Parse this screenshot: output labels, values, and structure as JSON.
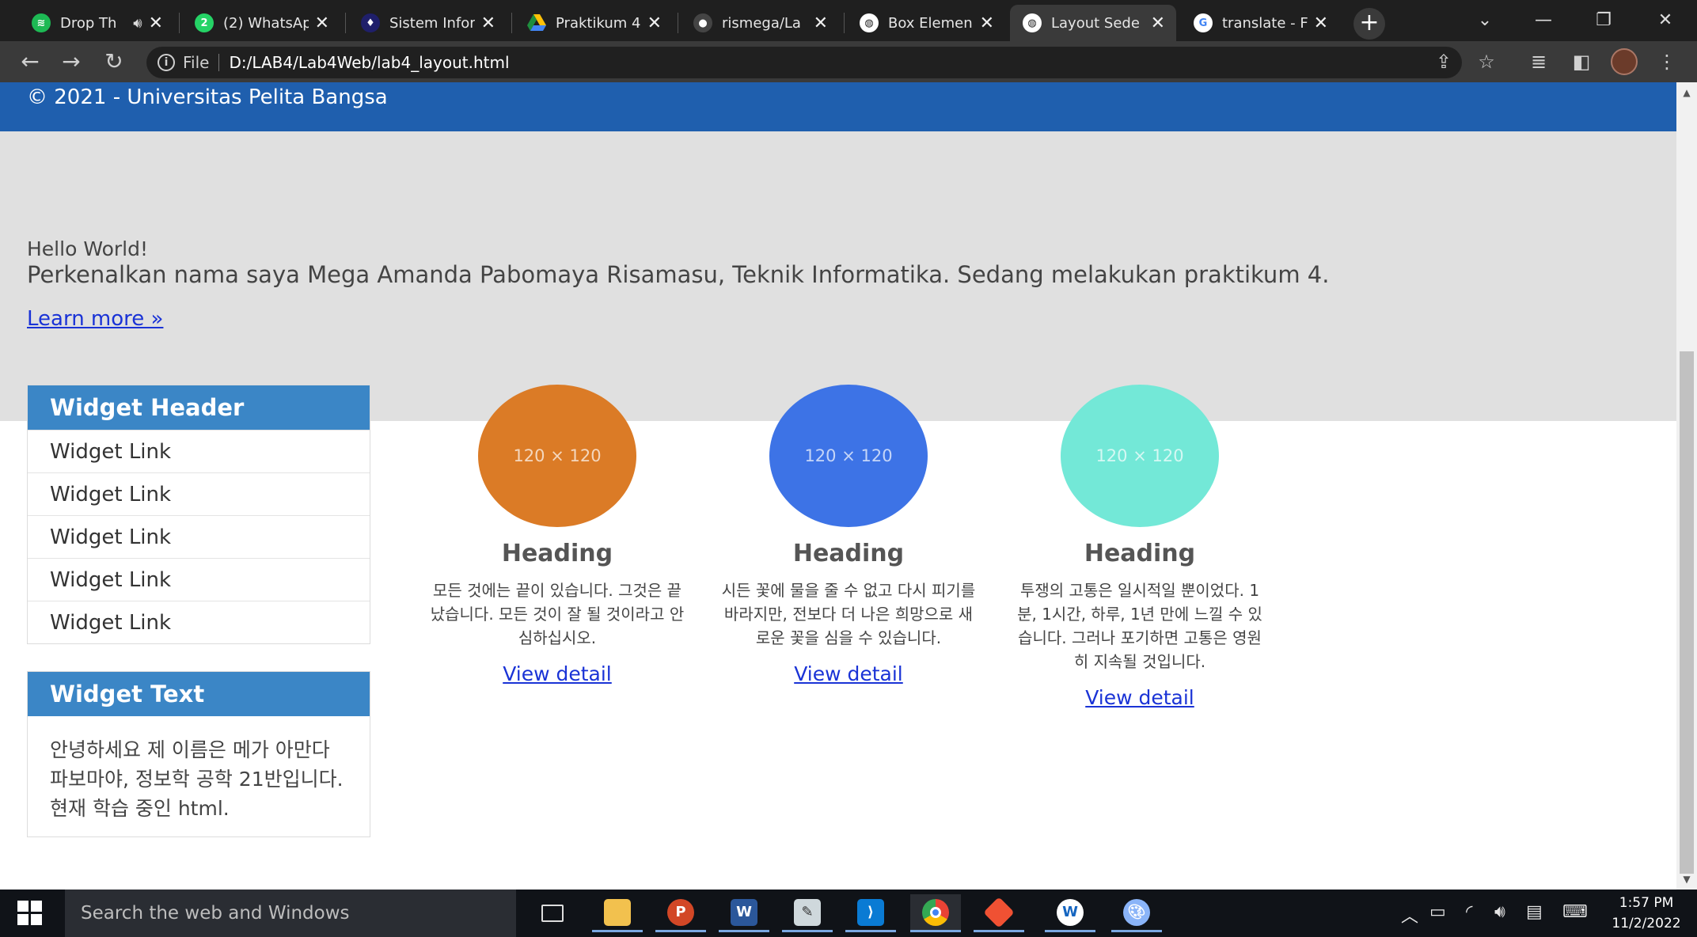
{
  "browser": {
    "tabs": [
      {
        "title": "Drop Th",
        "favicon": "spotify-icon",
        "color": "#1db954",
        "audio": true
      },
      {
        "title": "(2) WhatsAp",
        "favicon": "whatsapp-icon",
        "color": "#25d366",
        "badge": "2"
      },
      {
        "title": "Sistem Infor",
        "favicon": "university-icon",
        "color": "#3a3a9a"
      },
      {
        "title": "Praktikum 4",
        "favicon": "google-drive-icon",
        "color": "#f4b400"
      },
      {
        "title": "rismega/La",
        "favicon": "github-icon",
        "color": "#333333"
      },
      {
        "title": "Box Elemen",
        "favicon": "globe-icon",
        "color": "#ffffff"
      },
      {
        "title": "Layout Sede",
        "favicon": "globe-icon",
        "color": "#ffffff",
        "active": true
      },
      {
        "title": "translate - F",
        "favicon": "google-icon",
        "color": "#4285f4"
      }
    ],
    "address": {
      "scheme_label": "File",
      "url": "D:/LAB4/Lab4Web/lab4_layout.html"
    }
  },
  "page": {
    "footer_text": "© 2021 - Universitas Pelita Bangsa",
    "hero": {
      "greeting": "Hello World!",
      "intro": "Perkenalkan nama saya Mega Amanda Pabomaya Risamasu, Teknik Informatika. Sedang melakukan praktikum 4.",
      "link": "Learn more »"
    },
    "widget_links": {
      "header": "Widget Header",
      "items": [
        "Widget Link",
        "Widget Link",
        "Widget Link",
        "Widget Link",
        "Widget Link"
      ]
    },
    "widget_text": {
      "header": "Widget Text",
      "body": "안녕하세요 제 이름은 메가 아만다 파보마야, 정보학 공학 21반입니다. 현재 학습 중인 html."
    },
    "features": [
      {
        "placeholder": "120 × 120",
        "color": "#db7b26",
        "heading": "Heading",
        "text": "모든 것에는 끝이 있습니다. 그것은 끝났습니다. 모든 것이 잘 될 것이라고 안심하십시오.",
        "link": "View detail"
      },
      {
        "placeholder": "120 × 120",
        "color": "#3d73e6",
        "heading": "Heading",
        "text": "시든 꽃에 물을 줄 수 없고 다시 피기를 바라지만, 전보다 더 나은 희망으로 새로운 꽃을 심을 수 있습니다.",
        "link": "View detail"
      },
      {
        "placeholder": "120 × 120",
        "color": "#73e8d7",
        "heading": "Heading",
        "text": "투쟁의 고통은 일시적일 뿐이었다. 1분, 1시간, 하루, 1년 만에 느낄 수 있습니다. 그러나 포기하면 고통은 영원히 지속될 것입니다.",
        "link": "View detail"
      }
    ]
  },
  "taskbar": {
    "search_placeholder": "Search the web and Windows",
    "time": "1:57 PM",
    "date": "11/2/2022"
  }
}
